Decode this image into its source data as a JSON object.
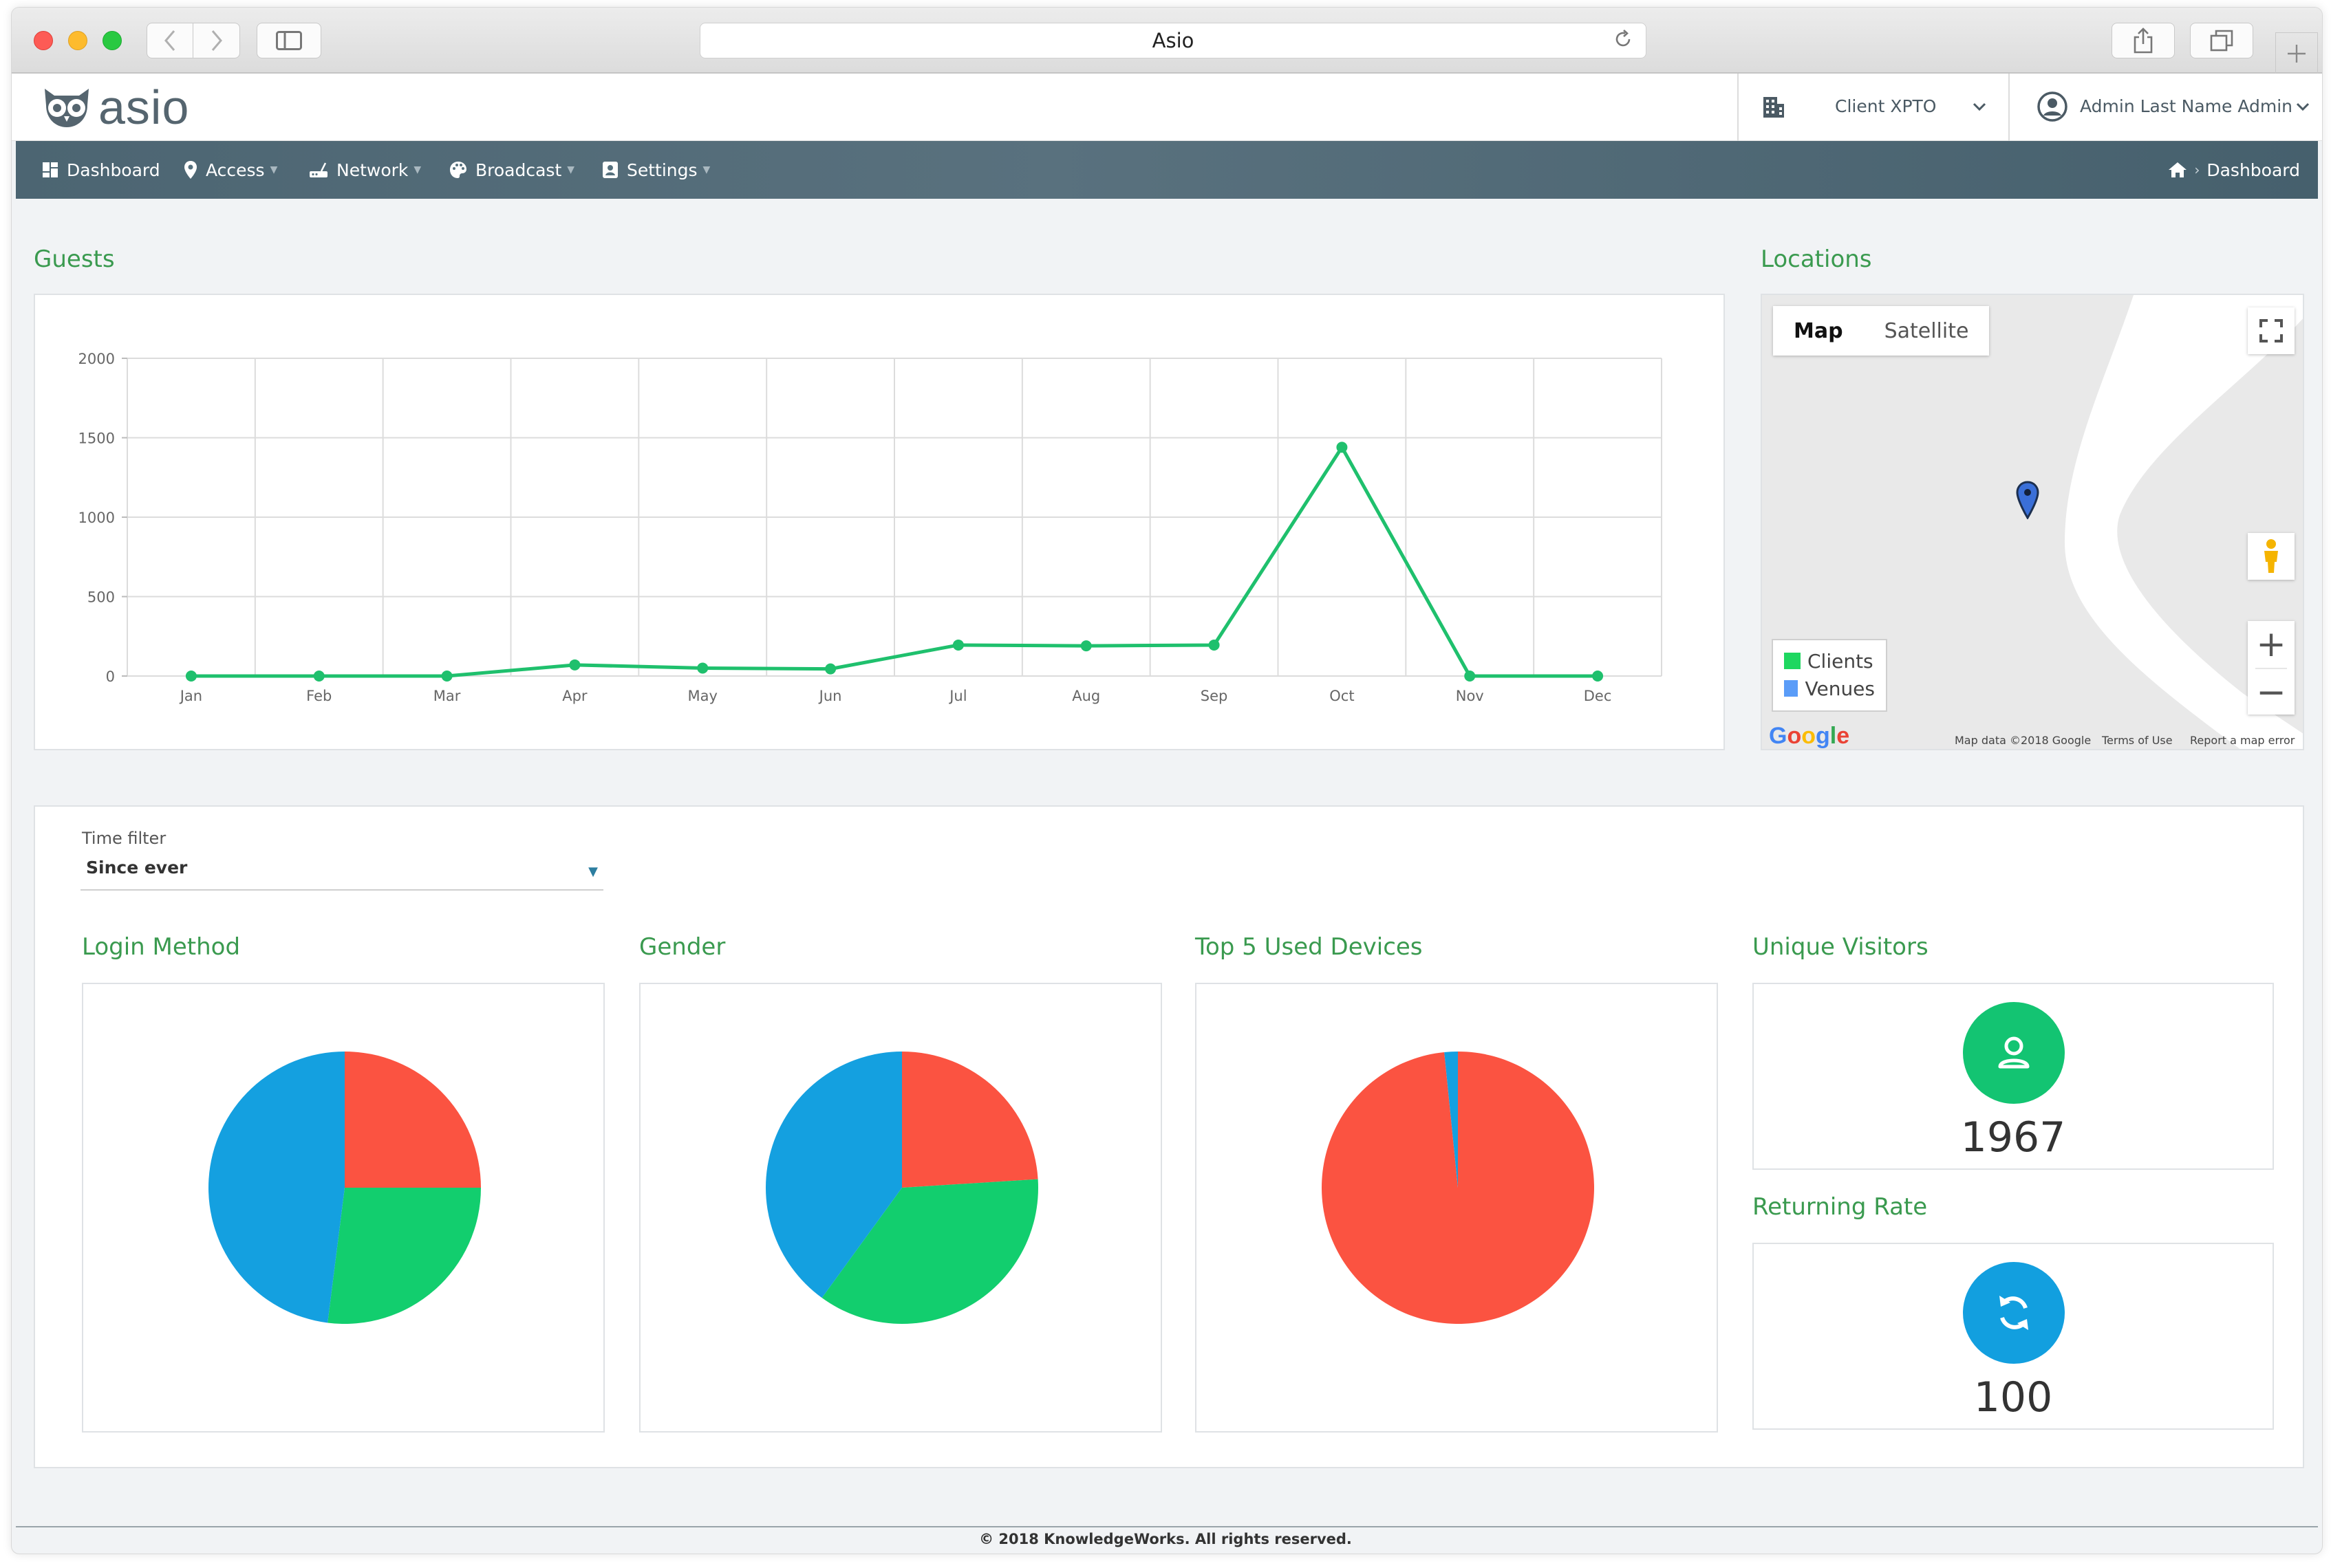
{
  "browser": {
    "address_bar_text": "Asio"
  },
  "app": {
    "logo_text": "asio",
    "client": {
      "name": "Client XPTO"
    },
    "user": {
      "name": "Admin Last Name Admin"
    }
  },
  "nav": {
    "items": [
      {
        "label": "Dashboard",
        "icon": "dashboard-icon"
      },
      {
        "label": "Access",
        "icon": "map-marker-icon"
      },
      {
        "label": "Network",
        "icon": "router-icon"
      },
      {
        "label": "Broadcast",
        "icon": "palette-icon"
      },
      {
        "label": "Settings",
        "icon": "id-badge-icon"
      }
    ],
    "breadcrumb": {
      "label": "Dashboard",
      "icon": "home-icon"
    }
  },
  "colors": {
    "accent_green": "#3a9a4f",
    "line_green": "#1fc06d",
    "pie_red": "#fb5341",
    "pie_blue": "#14a0e0",
    "pie_green": "#12ce6e",
    "kpi_green": "#13c472",
    "kpi_blue": "#129fdf",
    "nav_bg": "#4f6875"
  },
  "guests": {
    "title": "Guests"
  },
  "chart_data": [
    {
      "type": "line",
      "title": "",
      "x": [
        "Jan",
        "Feb",
        "Mar",
        "Apr",
        "May",
        "Jun",
        "Jul",
        "Aug",
        "Sep",
        "Oct",
        "Nov",
        "Dec"
      ],
      "series": [
        {
          "values": [
            0,
            0,
            0,
            70,
            50,
            45,
            195,
            190,
            195,
            1440,
            0,
            0
          ]
        }
      ],
      "yticks": [
        0,
        500,
        1000,
        1500,
        2000
      ],
      "ylim": [
        0,
        2000
      ],
      "grid": true
    },
    {
      "type": "pie",
      "title": "Login Method",
      "values": [
        25,
        27,
        48
      ],
      "colors": [
        "#fb5341",
        "#12ce6e",
        "#14a0e0"
      ]
    },
    {
      "type": "pie",
      "title": "Gender",
      "values": [
        24,
        36,
        40
      ],
      "colors": [
        "#fb5341",
        "#12ce6e",
        "#14a0e0"
      ]
    },
    {
      "type": "pie",
      "title": "Top 5 Used Devices",
      "values": [
        98.4,
        1.6
      ],
      "colors": [
        "#fb5341",
        "#14a0e0"
      ]
    }
  ],
  "locations": {
    "title": "Locations",
    "map_type": {
      "map": "Map",
      "satellite": "Satellite"
    },
    "legend": [
      {
        "label": "Clients",
        "color": "#1ed760"
      },
      {
        "label": "Venues",
        "color": "#5a9cf8"
      }
    ],
    "zoom_in": "+",
    "zoom_out": "−",
    "google_logo": "Google",
    "map_data": "Map data ©2018 Google",
    "terms": "Terms of Use",
    "report": "Report a map error"
  },
  "filters": {
    "time_filter_label": "Time filter",
    "time_filter_value": "Since ever"
  },
  "login_method": {
    "title": "Login Method"
  },
  "gender": {
    "title": "Gender"
  },
  "devices": {
    "title": "Top 5 Used Devices"
  },
  "unique_visitors": {
    "title": "Unique Visitors",
    "value": "1967",
    "icon": "user-icon"
  },
  "returning_rate": {
    "title": "Returning Rate",
    "value": "100",
    "icon": "refresh-icon"
  },
  "footer": {
    "text": "© 2018 KnowledgeWorks. All rights reserved."
  }
}
